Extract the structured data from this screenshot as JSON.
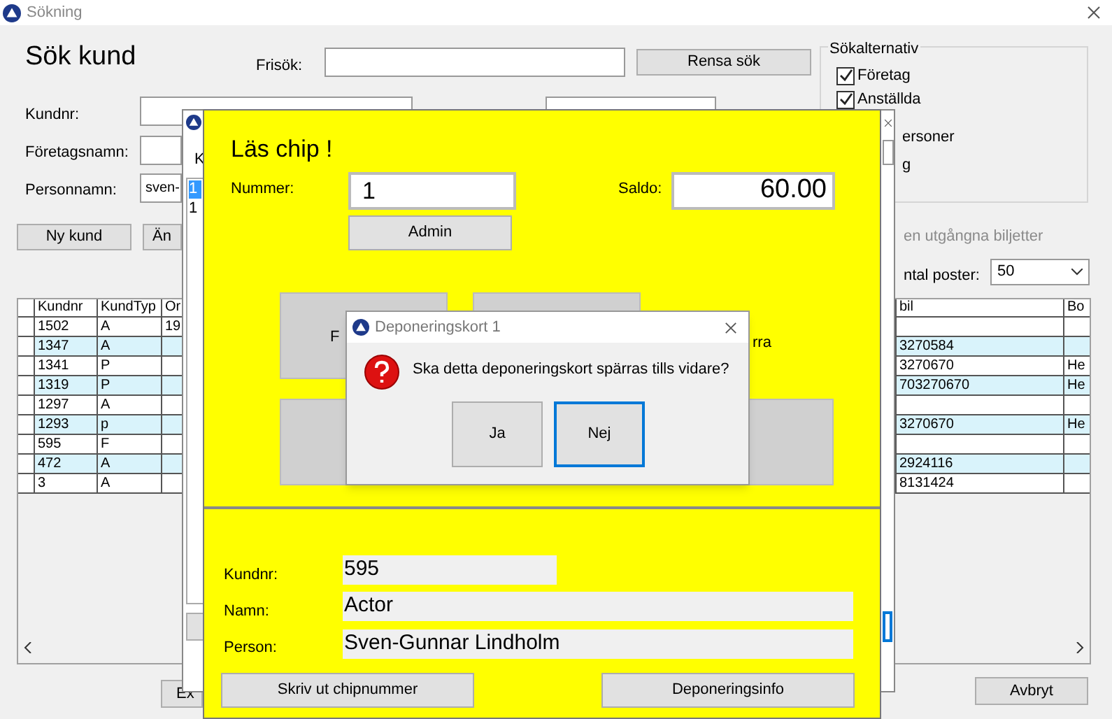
{
  "window": {
    "title": "Sökning"
  },
  "search": {
    "heading": "Sök kund",
    "free_label": "Frisök:",
    "clear_button": "Rensa sök",
    "fields": [
      {
        "label": "Kundnr:"
      },
      {
        "label": "Företagsnamn:"
      },
      {
        "label": "Personnamn:",
        "value": "sven-"
      }
    ],
    "buttons": [
      "Ny kund",
      "Än"
    ]
  },
  "options": {
    "title": "Sökalternativ",
    "checkboxes": [
      {
        "label": "Företag",
        "checked": true
      },
      {
        "label": "Anställda",
        "checked": true
      }
    ],
    "fragments": [
      "ersoner",
      "g"
    ],
    "expired_fragment": "en utgångna biljetter",
    "count_label_fragment": "ntal poster:",
    "count_value": "50"
  },
  "table": {
    "columns": [
      "Kundnr",
      "KundTyp",
      "Or",
      "bil",
      "Bo"
    ],
    "rows": [
      {
        "kundnr": "1502",
        "kundtyp": "A",
        "column_3": "19",
        "column_4": "",
        "column_5": "",
        "shaded": false
      },
      {
        "kundnr": "1347",
        "kundtyp": "A",
        "column_3": "",
        "column_4": "3270584",
        "column_5": "",
        "shaded": true
      },
      {
        "kundnr": "1341",
        "kundtyp": "P",
        "column_3": "",
        "column_4": "3270670",
        "column_5": "He",
        "shaded": false
      },
      {
        "kundnr": "1319",
        "kundtyp": "P",
        "column_3": "",
        "column_4": "703270670",
        "column_5": "He",
        "shaded": true
      },
      {
        "kundnr": "1297",
        "kundtyp": "A",
        "column_3": "",
        "column_4": "",
        "column_5": "",
        "shaded": false
      },
      {
        "kundnr": "1293",
        "kundtyp": "p",
        "column_3": "",
        "column_4": "3270670",
        "column_5": "He",
        "shaded": true
      },
      {
        "kundnr": "595",
        "kundtyp": "F",
        "column_3": "",
        "column_4": "",
        "column_5": "",
        "shaded": false
      },
      {
        "kundnr": "472",
        "kundtyp": "A",
        "column_3": "",
        "column_4": "2924116",
        "column_5": "",
        "shaded": true
      },
      {
        "kundnr": "3",
        "kundtyp": "A",
        "column_3": "",
        "column_4": "8131424",
        "column_5": "",
        "shaded": false
      }
    ]
  },
  "bottom_buttons": [
    "Ex",
    "Avbryt"
  ],
  "middle_window": {
    "label_fragment": "K",
    "list": [
      {
        "text": "1",
        "selected": true
      },
      {
        "text": "1",
        "selected": false
      }
    ]
  },
  "chip": {
    "title": "Läs chip !",
    "number_label": "Nummer:",
    "number": "1",
    "admin_button": "Admin",
    "balance_label": "Saldo:",
    "balance": "60.00",
    "tile_fragments": [
      "F",
      "rra"
    ]
  },
  "customer": {
    "fields": [
      {
        "label": "Kundnr:",
        "value": "595"
      },
      {
        "label": "Namn:",
        "value": "Actor"
      },
      {
        "label": "Person:",
        "value": "Sven-Gunnar Lindholm"
      }
    ],
    "buttons": [
      "Skriv ut chipnummer",
      "Deponeringsinfo"
    ]
  },
  "dialog": {
    "title": "Deponeringskort 1",
    "message": "Ska detta deponeringskort spärras tills vidare?",
    "buttons": [
      {
        "label": "Ja",
        "focused": false
      },
      {
        "label": "Nej",
        "focused": true
      }
    ]
  }
}
